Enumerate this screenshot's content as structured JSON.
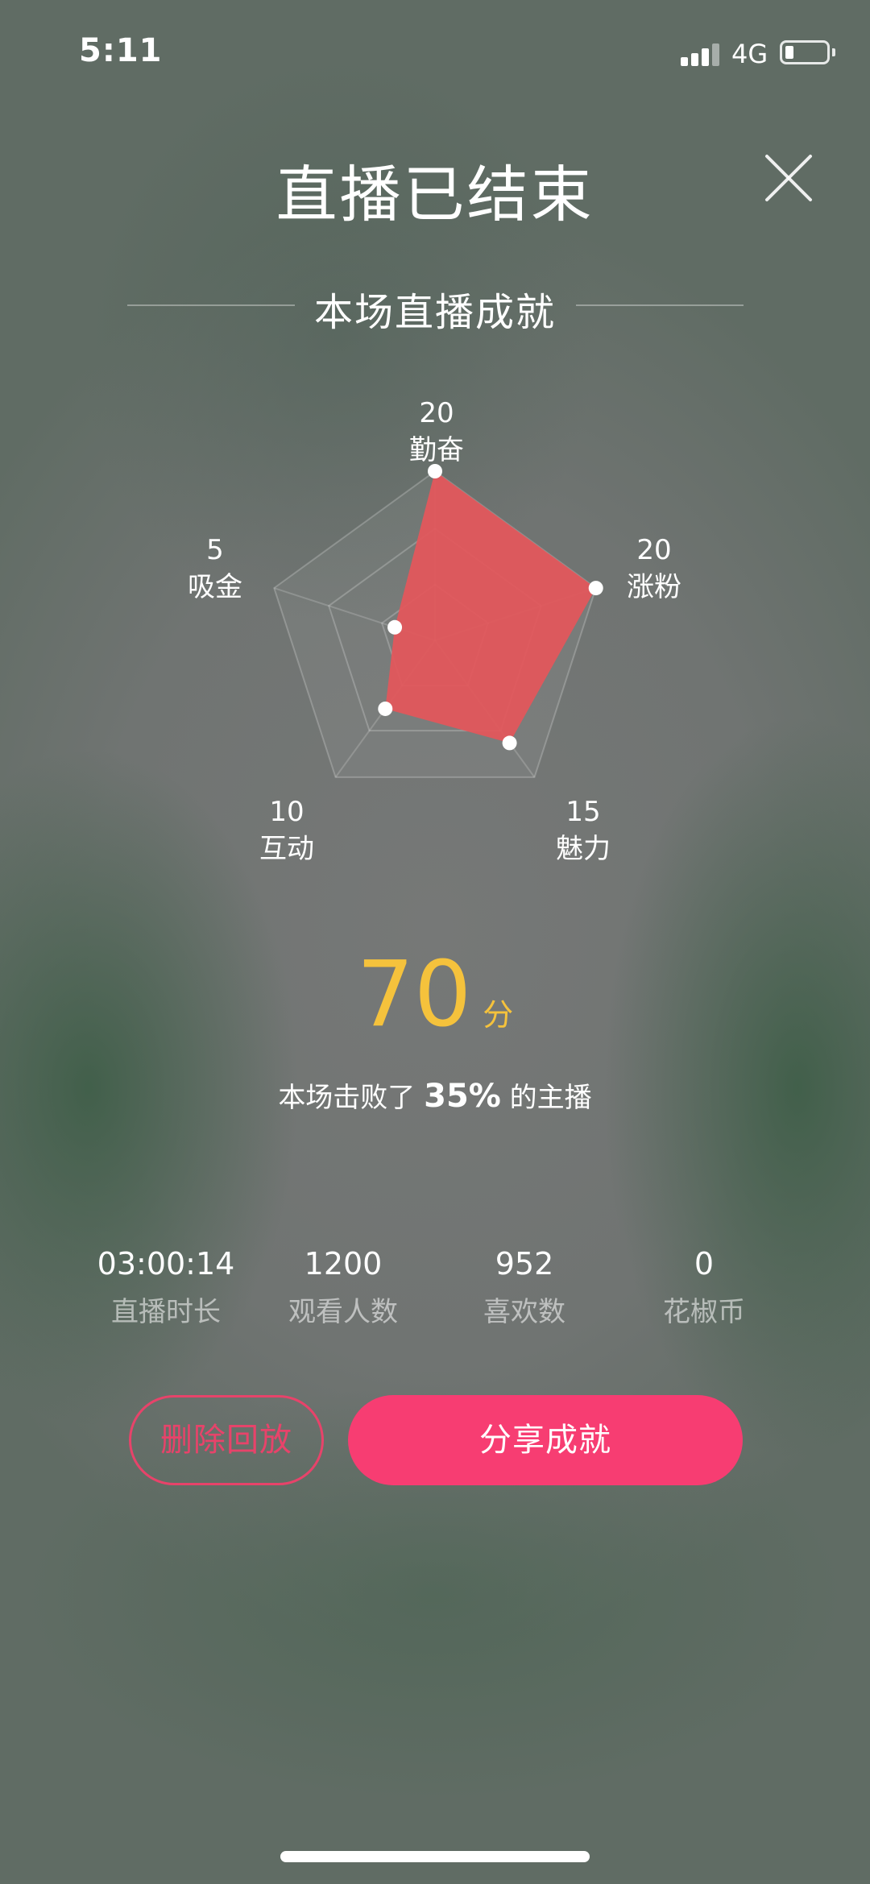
{
  "status_bar": {
    "time": "5:11",
    "network": "4G",
    "battery_level": 0.2
  },
  "header": {
    "title": "直播已结束"
  },
  "section": {
    "heading": "本场直播成就"
  },
  "radar": {
    "max": 20,
    "axes": [
      {
        "key": "qinfen",
        "label": "勤奋",
        "value": 20
      },
      {
        "key": "zhangfen",
        "label": "涨粉",
        "value": 20
      },
      {
        "key": "meili",
        "label": "魅力",
        "value": 15
      },
      {
        "key": "hudong",
        "label": "互动",
        "value": 10
      },
      {
        "key": "xijin",
        "label": "吸金",
        "value": 5
      }
    ],
    "fill_color": "#e2575c"
  },
  "score": {
    "value": "70",
    "unit": "分"
  },
  "beat": {
    "prefix": "本场击败了 ",
    "percent": "35%",
    "suffix": " 的主播"
  },
  "stats": [
    {
      "value": "03:00:14",
      "label": "直播时长"
    },
    {
      "value": "1200",
      "label": "观看人数"
    },
    {
      "value": "952",
      "label": "喜欢数"
    },
    {
      "value": "0",
      "label": "花椒币"
    }
  ],
  "actions": {
    "delete_replay": "删除回放",
    "share": "分享成就"
  },
  "colors": {
    "accent": "#f73d72",
    "score": "#f5c23c"
  }
}
